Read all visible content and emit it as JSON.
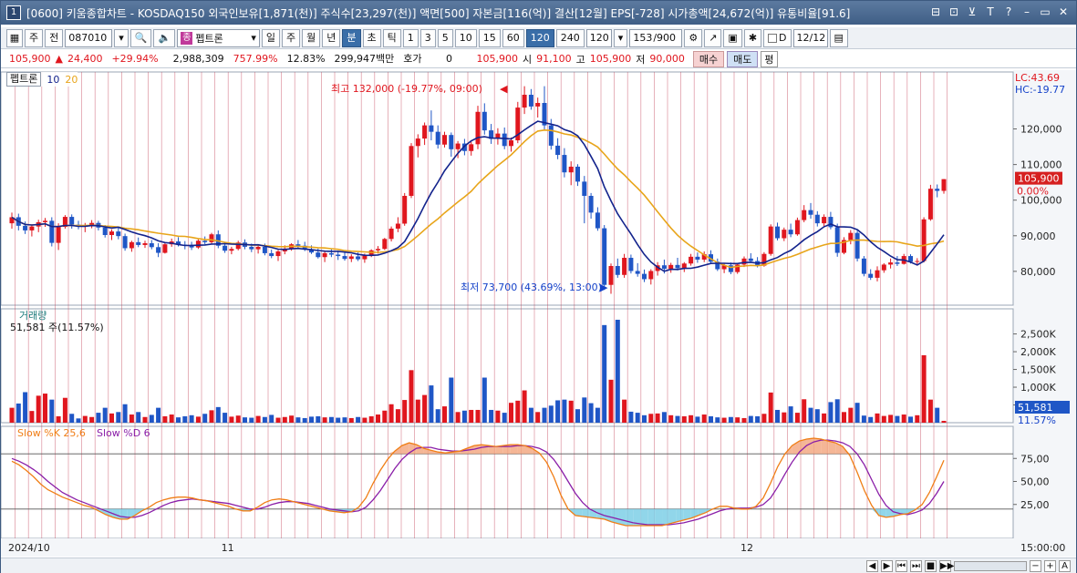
{
  "window": {
    "icon_label": "1",
    "title": "[0600] 키움종합차트 - KOSDAQ150 외국인보유[1,871(천)] 주식수[23,297(천)] 액면[500] 자본금[116(억)] 결산[12월] EPS[-728] 시가총액[24,672(억)] 유통비율[91.6]",
    "title_buttons": [
      "⊟",
      "⊡",
      "⊻",
      "T",
      "?",
      "–",
      "▭",
      "✕"
    ]
  },
  "toolbar": {
    "period_weekly": "주",
    "prev_label": "전",
    "code_value": "087010",
    "stock_tag": "종",
    "stock_name": "펩트론",
    "periods": [
      "일",
      "주",
      "월",
      "년",
      "분",
      "초",
      "틱"
    ],
    "active_period": "분",
    "intervals": [
      "1",
      "3",
      "5",
      "10",
      "15",
      "60",
      "120",
      "240"
    ],
    "active_interval": "120",
    "interval_select": "120",
    "bar_count": "153",
    "bar_total": "/900",
    "d_label": "D",
    "date_value": "12/12"
  },
  "quote": {
    "price": "105,900",
    "arrow": "▲",
    "change": "24,400",
    "change_pct": "+29.94%",
    "volume": "2,988,309",
    "vol_ratio": "757.99%",
    "turnover": "12.83%",
    "amount": "299,947백만",
    "bid_label": "호가",
    "bid_value": "0",
    "current_price": "105,900",
    "open_label": "시",
    "open": "91,100",
    "high_label": "고",
    "high": "105,900",
    "low_label": "저",
    "low": "90,000",
    "buy_label": "매수",
    "sell_label": "매도",
    "avg_label": "평"
  },
  "chart_data": {
    "type": "candlestick",
    "legend": {
      "name": "펩트론",
      "ma_short": "10",
      "ma_long": "20"
    },
    "colors": {
      "up": "#e0161e",
      "down": "#1f56c6",
      "ma_short": "#13238c",
      "ma_long": "#e8a51a",
      "grid_v": "#c0394f",
      "slowk": "#f07e16",
      "slowd": "#8a1ea8",
      "vol_highlight": "#1f56c6"
    },
    "annotations": {
      "high": "최고 132,000 (-19.77%, 09:00)",
      "low": "최저 73,700 (43.69%, 13:00)",
      "lc": "LC:43.69",
      "hc": "HC:-19.77",
      "last_price": "105,900",
      "last_pct": "0.00%"
    },
    "price_axis": {
      "ticks": [
        "120,000",
        "110,000",
        "100,000",
        "90,000",
        "80,000"
      ],
      "values": [
        120000,
        110000,
        100000,
        90000,
        80000
      ],
      "ylim": [
        70500,
        136000
      ]
    },
    "volume_panel": {
      "label": "거래량",
      "current": "51,581 주(11.57%)",
      "ticks": [
        "2,500K",
        "2,000K",
        "1,500K",
        "1,000K",
        "500K"
      ],
      "tick_values": [
        2500,
        2000,
        1500,
        1000,
        500
      ],
      "last_value": "51,581",
      "last_pct": "11.57%",
      "ylim": [
        0,
        2900
      ]
    },
    "stoch_panel": {
      "label_k": "Slow %K 25,6",
      "label_d": "Slow %D 6",
      "ticks": [
        "75,00",
        "50,00",
        "25,00"
      ],
      "tick_values": [
        75,
        50,
        25
      ],
      "ylim": [
        0,
        100
      ],
      "upper": 80,
      "lower": 20
    },
    "x_axis": {
      "labels": [
        "2024/10",
        "11",
        "12"
      ],
      "label_index": [
        0,
        32,
        110
      ],
      "last_label": "15:00:00"
    },
    "candles": [
      [
        93500,
        96500,
        92000,
        95200
      ],
      [
        95200,
        96200,
        91500,
        92800
      ],
      [
        92800,
        94000,
        90500,
        91500
      ],
      [
        91500,
        93200,
        89800,
        92600
      ],
      [
        92600,
        94500,
        91000,
        93800
      ],
      [
        93800,
        95000,
        92500,
        94200
      ],
      [
        94200,
        95200,
        87000,
        88000
      ],
      [
        88000,
        93500,
        86000,
        92500
      ],
      [
        92500,
        95800,
        92000,
        95300
      ],
      [
        95300,
        96000,
        92000,
        93100
      ],
      [
        93100,
        94200,
        91800,
        92600
      ],
      [
        92600,
        93600,
        91000,
        93000
      ],
      [
        93000,
        94400,
        92100,
        93600
      ],
      [
        93600,
        94200,
        91500,
        92300
      ],
      [
        92300,
        93000,
        89500,
        90200
      ],
      [
        90200,
        91800,
        88800,
        91200
      ],
      [
        91200,
        92200,
        89000,
        89900
      ],
      [
        89900,
        90600,
        85800,
        86500
      ],
      [
        86500,
        88600,
        85500,
        88200
      ],
      [
        88200,
        89500,
        86800,
        87400
      ],
      [
        87400,
        88600,
        86600,
        87900
      ],
      [
        87900,
        88800,
        86200,
        86800
      ],
      [
        86800,
        87900,
        84000,
        85200
      ],
      [
        85200,
        88000,
        85000,
        87600
      ],
      [
        87600,
        89200,
        86900,
        88400
      ],
      [
        88400,
        89600,
        87000,
        87500
      ],
      [
        87500,
        88500,
        86200,
        87200
      ],
      [
        87200,
        88300,
        86000,
        86700
      ],
      [
        86700,
        89000,
        86300,
        88600
      ],
      [
        88600,
        89800,
        87600,
        88200
      ],
      [
        88200,
        90800,
        87800,
        90400
      ],
      [
        90400,
        91500,
        86500,
        87200
      ],
      [
        87200,
        88100,
        85200,
        85800
      ],
      [
        85800,
        86900,
        84800,
        86300
      ],
      [
        86300,
        88600,
        85900,
        88100
      ],
      [
        88100,
        89000,
        86200,
        86900
      ],
      [
        86900,
        87800,
        85400,
        86200
      ],
      [
        86200,
        87500,
        85000,
        86900
      ],
      [
        86900,
        87800,
        84500,
        85100
      ],
      [
        85100,
        86100,
        83700,
        84300
      ],
      [
        84300,
        86000,
        82900,
        85600
      ],
      [
        85600,
        87300,
        84800,
        86400
      ],
      [
        86400,
        87900,
        85800,
        87600
      ],
      [
        87600,
        88800,
        86600,
        87200
      ],
      [
        87200,
        88300,
        85700,
        86100
      ],
      [
        86100,
        87300,
        84900,
        85300
      ],
      [
        85300,
        86400,
        83600,
        84000
      ],
      [
        84000,
        85600,
        82600,
        85100
      ],
      [
        85100,
        86200,
        84000,
        84700
      ],
      [
        84700,
        85800,
        83200,
        84300
      ],
      [
        84300,
        85600,
        83000,
        83500
      ],
      [
        83500,
        84800,
        82600,
        84200
      ],
      [
        84200,
        85300,
        82900,
        83400
      ],
      [
        83400,
        85000,
        82400,
        84500
      ],
      [
        84500,
        86200,
        84000,
        85900
      ],
      [
        85900,
        87100,
        85000,
        86300
      ],
      [
        86300,
        89400,
        86000,
        89100
      ],
      [
        89100,
        92600,
        88400,
        92000
      ],
      [
        92000,
        95200,
        91000,
        93400
      ],
      [
        93400,
        102000,
        92800,
        101200
      ],
      [
        101200,
        116000,
        100600,
        115200
      ],
      [
        115200,
        118500,
        112000,
        117300
      ],
      [
        117300,
        121800,
        115500,
        121000
      ],
      [
        121000,
        125200,
        116800,
        119200
      ],
      [
        119200,
        121000,
        114500,
        115600
      ],
      [
        115600,
        119200,
        114800,
        118300
      ],
      [
        118300,
        119000,
        112200,
        114300
      ],
      [
        114300,
        116600,
        111800,
        115900
      ],
      [
        115900,
        117200,
        112600,
        113800
      ],
      [
        113800,
        116400,
        112500,
        115700
      ],
      [
        115700,
        126500,
        114300,
        124800
      ],
      [
        124800,
        127200,
        118400,
        119600
      ],
      [
        119600,
        121400,
        115800,
        117200
      ],
      [
        117200,
        120200,
        115600,
        118700
      ],
      [
        118700,
        120400,
        114300,
        115200
      ],
      [
        115200,
        117600,
        113600,
        116800
      ],
      [
        116800,
        127600,
        116000,
        126000
      ],
      [
        126000,
        132000,
        124200,
        129600
      ],
      [
        129600,
        131200,
        125400,
        126300
      ],
      [
        126300,
        128800,
        123200,
        127300
      ],
      [
        127300,
        132000,
        119600,
        121000
      ],
      [
        121000,
        122800,
        114200,
        115300
      ],
      [
        115300,
        117400,
        111500,
        112700
      ],
      [
        112700,
        114600,
        106400,
        107800
      ],
      [
        107800,
        110900,
        104200,
        109400
      ],
      [
        109400,
        110100,
        104000,
        105200
      ],
      [
        105200,
        106800,
        93500,
        101200
      ],
      [
        101200,
        102000,
        94800,
        96500
      ],
      [
        96500,
        98000,
        91400,
        92100
      ],
      [
        92100,
        93000,
        74800,
        76200
      ],
      [
        76200,
        82200,
        73700,
        81500
      ],
      [
        81500,
        83600,
        78200,
        79000
      ],
      [
        79000,
        84900,
        78200,
        83800
      ],
      [
        83800,
        84700,
        79400,
        80100
      ],
      [
        80100,
        82300,
        78500,
        79300
      ],
      [
        79300,
        80500,
        77000,
        77800
      ],
      [
        77800,
        80600,
        76300,
        80100
      ],
      [
        80100,
        82600,
        78800,
        81700
      ],
      [
        81700,
        83300,
        79400,
        80700
      ],
      [
        80700,
        82400,
        79600,
        81800
      ],
      [
        81800,
        83800,
        80300,
        80900
      ],
      [
        80900,
        82600,
        79800,
        82200
      ],
      [
        82200,
        84900,
        81600,
        84100
      ],
      [
        84100,
        85300,
        82400,
        83300
      ],
      [
        83300,
        85600,
        82600,
        84800
      ],
      [
        84800,
        85900,
        82200,
        82700
      ],
      [
        82700,
        83600,
        80100,
        80600
      ],
      [
        80600,
        82200,
        79500,
        81700
      ],
      [
        81700,
        82500,
        79200,
        79800
      ],
      [
        79800,
        82300,
        79300,
        81900
      ],
      [
        81900,
        84200,
        81200,
        83600
      ],
      [
        83600,
        85100,
        82600,
        82900
      ],
      [
        82900,
        84000,
        81100,
        81600
      ],
      [
        81600,
        85400,
        81300,
        84900
      ],
      [
        84900,
        93200,
        84400,
        92600
      ],
      [
        92600,
        93700,
        88700,
        89300
      ],
      [
        89300,
        92300,
        88500,
        91700
      ],
      [
        91700,
        93400,
        89600,
        90400
      ],
      [
        90400,
        95100,
        90000,
        94400
      ],
      [
        94400,
        98600,
        93800,
        97200
      ],
      [
        97200,
        99200,
        94800,
        95900
      ],
      [
        95900,
        96900,
        92600,
        93500
      ],
      [
        93500,
        96000,
        92600,
        95300
      ],
      [
        95300,
        96700,
        91800,
        92400
      ],
      [
        92400,
        93400,
        84100,
        85200
      ],
      [
        85200,
        89600,
        84800,
        88800
      ],
      [
        88800,
        91600,
        87600,
        90800
      ],
      [
        90800,
        91400,
        82800,
        83600
      ],
      [
        83600,
        84300,
        78600,
        79300
      ],
      [
        79300,
        80600,
        77600,
        78200
      ],
      [
        78200,
        81400,
        77200,
        80300
      ],
      [
        80300,
        82300,
        79600,
        81900
      ],
      [
        81900,
        83600,
        80800,
        82500
      ],
      [
        82500,
        84300,
        81500,
        82100
      ],
      [
        82100,
        84900,
        81900,
        84300
      ],
      [
        84300,
        84800,
        82200,
        82700
      ],
      [
        82700,
        83700,
        81600,
        82900
      ],
      [
        82900,
        95200,
        82500,
        94600
      ],
      [
        94600,
        104300,
        94200,
        103200
      ],
      [
        103200,
        104400,
        100800,
        102600
      ],
      [
        102600,
        105900,
        101800,
        105900
      ]
    ],
    "volume": [
      420,
      540,
      860,
      330,
      760,
      820,
      650,
      180,
      700,
      250,
      120,
      190,
      160,
      280,
      420,
      260,
      300,
      520,
      230,
      300,
      160,
      220,
      420,
      180,
      230,
      150,
      180,
      210,
      170,
      250,
      350,
      440,
      280,
      170,
      200,
      150,
      140,
      190,
      160,
      220,
      140,
      160,
      200,
      150,
      130,
      170,
      180,
      150,
      160,
      140,
      150,
      130,
      160,
      140,
      180,
      230,
      340,
      520,
      380,
      640,
      1480,
      650,
      780,
      1050,
      380,
      460,
      1270,
      300,
      340,
      360,
      360,
      1270,
      360,
      340,
      280,
      560,
      620,
      910,
      420,
      300,
      420,
      480,
      630,
      650,
      620,
      380,
      710,
      550,
      420,
      2750,
      1210,
      2900,
      650,
      310,
      280,
      210,
      250,
      260,
      300,
      210,
      190,
      180,
      210,
      170,
      230,
      180,
      150,
      140,
      160,
      150,
      130,
      190,
      180,
      250,
      850,
      360,
      290,
      460,
      280,
      660,
      420,
      380,
      260,
      580,
      660,
      300,
      420,
      560,
      200,
      160,
      260,
      190,
      220,
      190,
      230,
      170,
      210,
      1900,
      650,
      420,
      52
    ],
    "slow_k": [
      72,
      68,
      62,
      55,
      47,
      41,
      37,
      33,
      30,
      27,
      24,
      22,
      18,
      14,
      11,
      9,
      9,
      13,
      18,
      22,
      27,
      30,
      32,
      33,
      33,
      32,
      30,
      29,
      27,
      25,
      23,
      20,
      18,
      18,
      22,
      27,
      30,
      31,
      30,
      28,
      26,
      24,
      22,
      20,
      18,
      17,
      16,
      17,
      22,
      32,
      48,
      62,
      74,
      83,
      89,
      92,
      90,
      86,
      84,
      82,
      81,
      82,
      83,
      86,
      89,
      90,
      89,
      88,
      89,
      90,
      90,
      89,
      86,
      81,
      71,
      55,
      35,
      20,
      13,
      12,
      11,
      10,
      9,
      6,
      4,
      2,
      2,
      2,
      2,
      2,
      2,
      4,
      6,
      8,
      10,
      13,
      16,
      20,
      23,
      23,
      21,
      20,
      20,
      23,
      32,
      48,
      66,
      80,
      89,
      94,
      96,
      97,
      96,
      94,
      92,
      88,
      78,
      60,
      40,
      24,
      13,
      11,
      12,
      14,
      15,
      19,
      25,
      38,
      55,
      73
    ],
    "slow_d": [
      75,
      72,
      68,
      63,
      57,
      50,
      44,
      38,
      34,
      30,
      27,
      24,
      21,
      18,
      15,
      12,
      11,
      11,
      13,
      16,
      20,
      24,
      27,
      29,
      30,
      31,
      30,
      29,
      28,
      27,
      26,
      24,
      22,
      20,
      20,
      22,
      25,
      27,
      28,
      28,
      27,
      26,
      24,
      22,
      20,
      19,
      18,
      17,
      18,
      22,
      30,
      40,
      52,
      64,
      74,
      81,
      86,
      87,
      87,
      85,
      84,
      83,
      83,
      84,
      85,
      87,
      88,
      88,
      88,
      88,
      89,
      89,
      88,
      86,
      82,
      74,
      63,
      50,
      37,
      27,
      20,
      16,
      13,
      11,
      9,
      7,
      5,
      4,
      3,
      3,
      3,
      3,
      4,
      5,
      7,
      9,
      12,
      15,
      18,
      20,
      21,
      21,
      21,
      22,
      25,
      32,
      44,
      58,
      71,
      82,
      89,
      93,
      95,
      95,
      94,
      92,
      88,
      80,
      68,
      52,
      36,
      24,
      17,
      15,
      14,
      16,
      19,
      26,
      37,
      50
    ]
  },
  "status": {
    "buttons": [
      "◀",
      "▶",
      "⏮",
      "⏭",
      "■",
      "▶▶"
    ],
    "zoom_labels": [
      "−",
      "+",
      "A"
    ]
  }
}
